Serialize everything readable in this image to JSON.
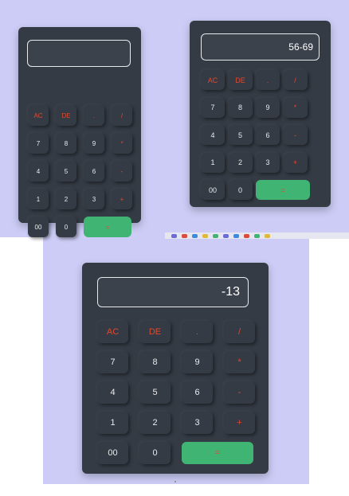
{
  "colors": {
    "page_background": "#ccccf6",
    "calculator_body": "#353b45",
    "operator_text": "#e2482f",
    "digit_text": "#e8eaee",
    "equals_background": "#3fb473"
  },
  "calculators": [
    {
      "display": "",
      "keys": [
        "AC",
        "DE",
        ".",
        "/",
        "7",
        "8",
        "9",
        "*",
        "4",
        "5",
        "6",
        "-",
        "1",
        "2",
        "3",
        "+",
        "00",
        "0",
        "="
      ]
    },
    {
      "display": "56-69",
      "keys": [
        "AC",
        "DE",
        ".",
        "/",
        "7",
        "8",
        "9",
        "*",
        "4",
        "5",
        "6",
        "-",
        "1",
        "2",
        "3",
        "+",
        "00",
        "0",
        "="
      ]
    },
    {
      "display": "-13",
      "keys": [
        "AC",
        "DE",
        ".",
        "/",
        "7",
        "8",
        "9",
        "*",
        "4",
        "5",
        "6",
        "-",
        "1",
        "2",
        "3",
        "+",
        "00",
        "0",
        "="
      ]
    }
  ]
}
